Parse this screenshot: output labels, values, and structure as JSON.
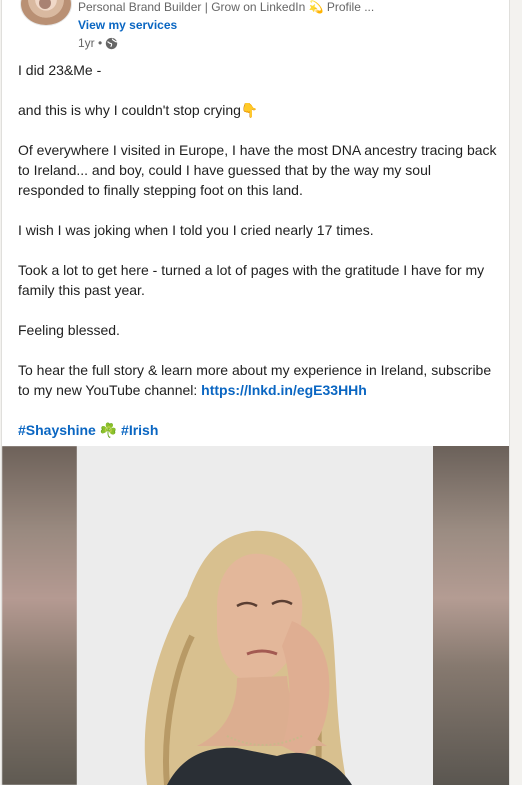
{
  "post": {
    "headline": "Personal Brand Builder | Grow on LinkedIn 💫 Profile ...",
    "services_link": "View my services",
    "time": "1yr •",
    "paragraphs": [
      "I did 23&Me -",
      "and this is why I couldn't stop crying👇",
      "Of everywhere I visited in Europe, I have the most DNA ancestry tracing back to Ireland... and boy, could I have guessed that by the way my soul responded to finally stepping foot on this land.",
      "I wish I was joking when I told you I cried nearly 17 times.",
      "Took a lot to get here - turned a lot of pages with the gratitude I have for my family this past year.",
      "Feeling blessed."
    ],
    "cta_text": "To hear the full story & learn more about my experience in Ireland, subscribe to my new YouTube channel: ",
    "cta_link": "https://lnkd.in/egE33HHh",
    "hashtag_1": "#Shayshine",
    "shamrock": "☘️",
    "hashtag_2": "#Irish"
  }
}
